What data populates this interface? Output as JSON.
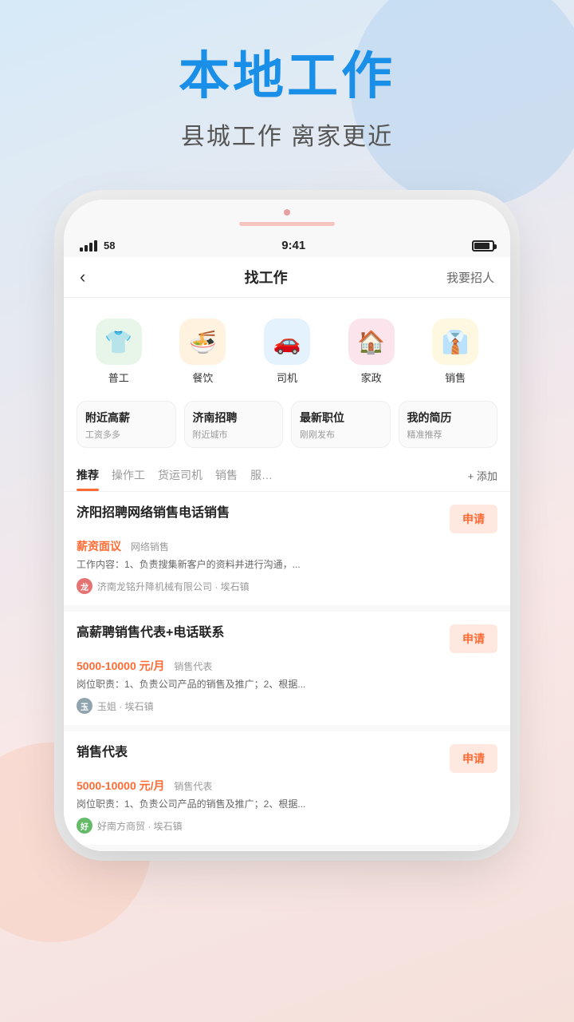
{
  "hero": {
    "title": "本地工作",
    "subtitle": "县城工作  离家更近"
  },
  "phone": {
    "status": {
      "signal_label": "signal",
      "carrier_number": "58",
      "time": "9:41",
      "battery_label": "battery"
    },
    "nav": {
      "back_icon": "‹",
      "title": "找工作",
      "action": "我要招人"
    },
    "categories": [
      {
        "icon": "👕",
        "label": "普工",
        "color": "#4caf50"
      },
      {
        "icon": "🍜",
        "label": "餐饮",
        "color": "#ff9800"
      },
      {
        "icon": "🚗",
        "label": "司机",
        "color": "#2196f3"
      },
      {
        "icon": "🏠",
        "label": "家政",
        "color": "#f44336"
      },
      {
        "icon": "👔",
        "label": "销售",
        "color": "#ff9800"
      }
    ],
    "quick_links": [
      {
        "title": "附近高薪",
        "sub": "工资多多"
      },
      {
        "title": "济南招聘",
        "sub": "附近城市"
      },
      {
        "title": "最新职位",
        "sub": "刚刚发布"
      },
      {
        "title": "我的简历",
        "sub": "精准推荐"
      }
    ],
    "tabs": [
      {
        "label": "推荐",
        "active": true
      },
      {
        "label": "操作工",
        "active": false
      },
      {
        "label": "货运司机",
        "active": false
      },
      {
        "label": "销售",
        "active": false
      },
      {
        "label": "服…",
        "active": false
      }
    ],
    "tab_add": "+ 添加",
    "jobs": [
      {
        "title": "济阳招聘网络销售电话销售",
        "salary": "薪资面议",
        "salary_tag": "网络销售",
        "desc": "工作内容：1、负责搜集新客户的资料并进行沟通，...",
        "company": "济南龙铭升降机械有限公司 · 埃石镇",
        "avatar_color": "#e57373",
        "avatar_text": "龙",
        "apply_label": "申请"
      },
      {
        "title": "高薪聘销售代表+电话联系",
        "salary": "5000-10000 元/月",
        "salary_tag": "销售代表",
        "desc": "岗位职责：1、负责公司产品的销售及推广；2、根据...",
        "company": "玉姐 · 埃石镇",
        "avatar_color": "#90a4ae",
        "avatar_text": "玉",
        "apply_label": "申请"
      },
      {
        "title": "销售代表",
        "salary": "5000-10000 元/月",
        "salary_tag": "销售代表",
        "desc": "岗位职责：1、负责公司产品的销售及推广；2、根据...",
        "company": "好南方商贸 · 埃石镇",
        "avatar_color": "#66bb6a",
        "avatar_text": "好",
        "apply_label": "申请"
      }
    ]
  }
}
